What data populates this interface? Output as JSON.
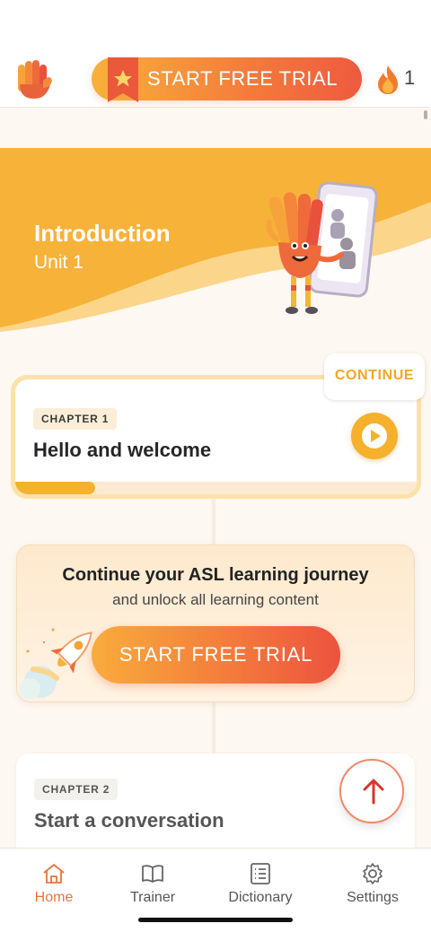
{
  "header": {
    "trial_button_label": "START FREE TRIAL",
    "streak_count": "1",
    "icons": [
      "hand-logo-icon",
      "star-ribbon-icon",
      "flame-icon"
    ]
  },
  "banner": {
    "title": "Introduction",
    "subtitle": "Unit 1"
  },
  "chapter1": {
    "chip": "CHAPTER 1",
    "title": "Hello and welcome",
    "continue_label": "CONTINUE",
    "progress": 0.2
  },
  "promo": {
    "heading": "Continue your ASL learning journey",
    "subheading": "and unlock all learning content",
    "button_label": "START FREE TRIAL"
  },
  "chapter2": {
    "chip": "CHAPTER 2",
    "title": "Start a conversation"
  },
  "nav": {
    "items": [
      {
        "label": "Home",
        "icon": "home-icon",
        "active": true
      },
      {
        "label": "Trainer",
        "icon": "book-icon",
        "active": false
      },
      {
        "label": "Dictionary",
        "icon": "list-icon",
        "active": false
      },
      {
        "label": "Settings",
        "icon": "gear-icon",
        "active": false
      }
    ]
  },
  "colors": {
    "accent_orange": "#f5a623",
    "gradient_start": "#f9ac3c",
    "gradient_end": "#ec523f",
    "active_nav": "#e9733e"
  }
}
